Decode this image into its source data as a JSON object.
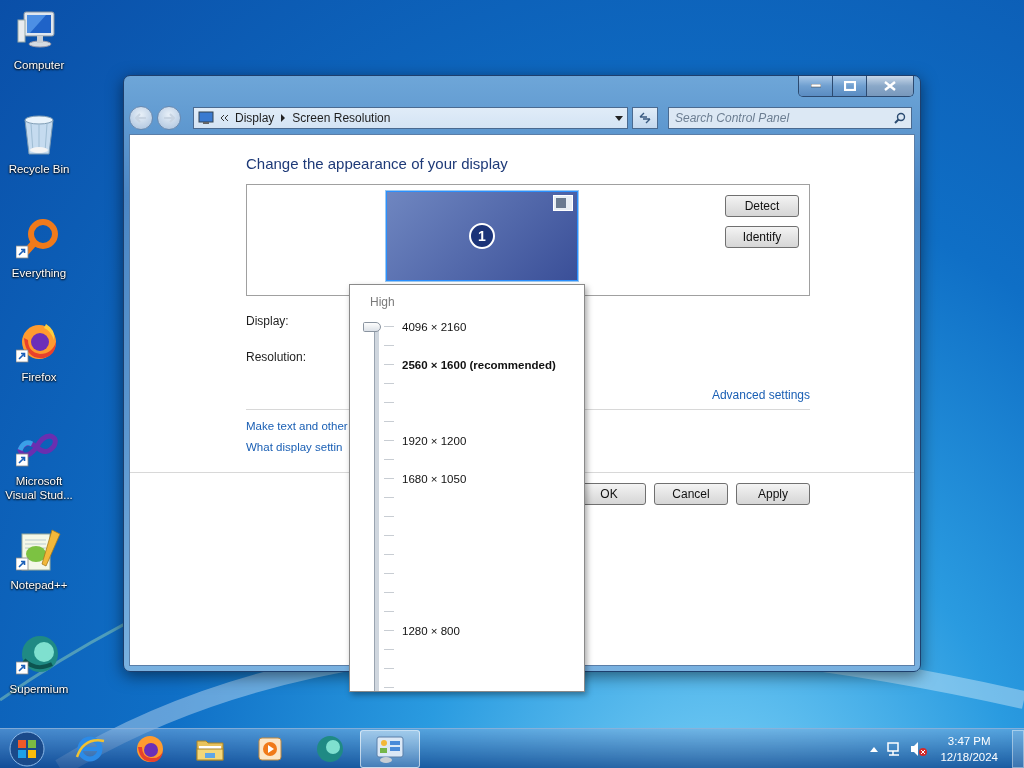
{
  "desktop_icons": [
    {
      "kind": "computer",
      "label": "Computer",
      "shortcut": false
    },
    {
      "kind": "recyclebin",
      "label": "Recycle Bin",
      "shortcut": false
    },
    {
      "kind": "everything",
      "label": "Everything",
      "shortcut": true
    },
    {
      "kind": "firefox",
      "label": "Firefox",
      "shortcut": true
    },
    {
      "kind": "visualstudio",
      "label": "Microsoft Visual Stud...",
      "shortcut": true
    },
    {
      "kind": "notepadpp",
      "label": "Notepad++",
      "shortcut": true
    },
    {
      "kind": "supermium",
      "label": "Supermium",
      "shortcut": true
    }
  ],
  "window": {
    "breadcrumb": [
      "Display",
      "Screen Resolution"
    ],
    "search": {
      "placeholder": "Search Control Panel"
    },
    "heading": "Change the appearance of your display",
    "monitor": {
      "number": "1",
      "selected": true
    },
    "side_buttons": [
      "Detect",
      "Identify"
    ],
    "fields": [
      {
        "label": "Display:"
      },
      {
        "label": "Resolution:"
      }
    ],
    "advanced_link": "Advanced settings",
    "links": [
      "Make text and other",
      "What display settin"
    ],
    "buttons": [
      "OK",
      "Cancel",
      "Apply"
    ]
  },
  "resolution_popup": {
    "caption": "High",
    "slider": {
      "level": 1
    },
    "stops": [
      {
        "kind": "option",
        "label": "4096 × 2160",
        "recommended": false
      },
      {
        "kind": "tick"
      },
      {
        "kind": "option",
        "label": "2560 × 1600 (recommended)",
        "recommended": true
      },
      {
        "kind": "tick"
      },
      {
        "kind": "tick"
      },
      {
        "kind": "tick"
      },
      {
        "kind": "option",
        "label": "1920 × 1200",
        "recommended": false
      },
      {
        "kind": "tick"
      },
      {
        "kind": "option",
        "label": "1680 × 1050",
        "recommended": false
      },
      {
        "kind": "tick"
      },
      {
        "kind": "tick"
      },
      {
        "kind": "tick"
      },
      {
        "kind": "tick"
      },
      {
        "kind": "tick"
      },
      {
        "kind": "tick"
      },
      {
        "kind": "tick"
      },
      {
        "kind": "option",
        "label": "1280 × 800",
        "recommended": false
      },
      {
        "kind": "tick"
      },
      {
        "kind": "tick"
      },
      {
        "kind": "tick"
      }
    ]
  },
  "taskbar": {
    "pinned": [
      {
        "kind": "ie",
        "active": false
      },
      {
        "kind": "firefox",
        "active": false
      },
      {
        "kind": "explorer",
        "active": false
      },
      {
        "kind": "mediaplayer",
        "active": false
      },
      {
        "kind": "supermium",
        "active": false
      },
      {
        "kind": "controlpanel",
        "active": true
      }
    ],
    "clock": {
      "time": "3:47 PM",
      "date": "12/18/2024"
    }
  }
}
